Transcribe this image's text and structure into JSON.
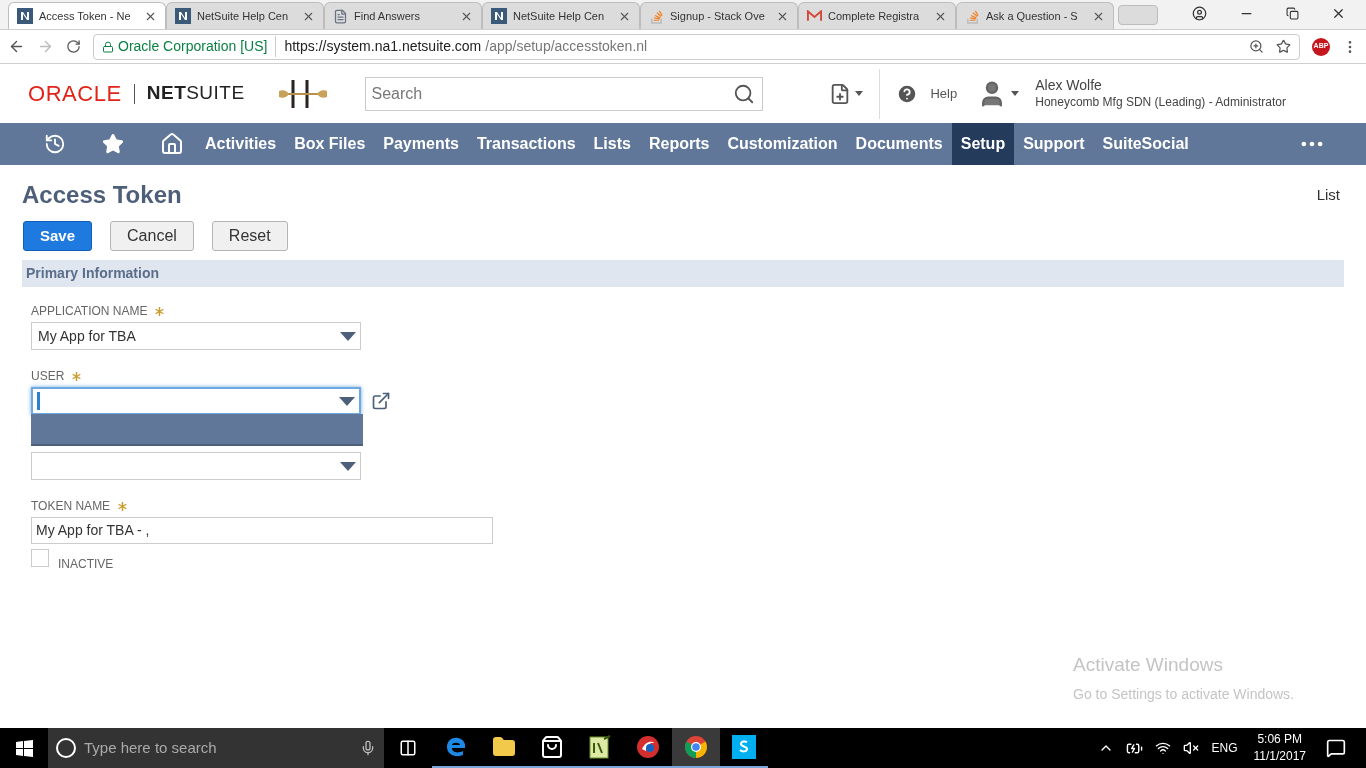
{
  "browser_tabs": [
    {
      "title": "Access Token - Ne",
      "kind": "netsuite",
      "selected": true
    },
    {
      "title": "NetSuite Help Cen",
      "kind": "netsuite",
      "selected": false
    },
    {
      "title": "Find Answers",
      "kind": "page",
      "selected": false
    },
    {
      "title": "NetSuite Help Cen",
      "kind": "netsuite",
      "selected": false
    },
    {
      "title": "Signup - Stack Ove",
      "kind": "stack",
      "selected": false
    },
    {
      "title": "Complete Registra",
      "kind": "mail",
      "selected": false
    },
    {
      "title": "Ask a Question - S",
      "kind": "stack",
      "selected": false
    }
  ],
  "address_bar": {
    "site_identity": "Oracle Corporation [US]",
    "url_host": "https://system.na1.netsuite.com",
    "url_path": "/app/setup/accesstoken.nl",
    "extension_badge": "ABP"
  },
  "header": {
    "oracle_logo": "ORACLE",
    "netsuite_logo": "**NET**SUITE",
    "search": {
      "placeholder": "Search"
    },
    "help": "Help",
    "user_name": "Alex Wolfe",
    "user_role": "Honeycomb Mfg SDN (Leading) - Administrator"
  },
  "nav": [
    {
      "label": "Activities",
      "selected": false
    },
    {
      "label": "Box Files",
      "selected": false
    },
    {
      "label": "Payments",
      "selected": false
    },
    {
      "label": "Transactions",
      "selected": false
    },
    {
      "label": "Lists",
      "selected": false
    },
    {
      "label": "Reports",
      "selected": false
    },
    {
      "label": "Customization",
      "selected": false
    },
    {
      "label": "Documents",
      "selected": false
    },
    {
      "label": "Setup",
      "selected": true
    },
    {
      "label": "Support",
      "selected": false
    },
    {
      "label": "SuiteSocial",
      "selected": false
    }
  ],
  "page": {
    "title": "Access Token",
    "list_link": "List",
    "buttons": [
      {
        "label": "Save",
        "kind": "primary"
      },
      {
        "label": "Cancel",
        "kind": "secondary"
      },
      {
        "label": "Reset",
        "kind": "secondary"
      }
    ],
    "section": "Primary Information",
    "fields": [
      {
        "kind": "select",
        "label": "APPLICATION NAME",
        "required": true,
        "value": "My App for TBA",
        "focused": false
      },
      {
        "kind": "select",
        "label": "USER",
        "required": true,
        "focused": true,
        "dropdown_open": true,
        "link_icon": true
      },
      {
        "kind": "select",
        "required": false,
        "focused": false
      },
      {
        "kind": "text",
        "label": "TOKEN NAME",
        "required": true,
        "value": "My App for TBA - ,"
      },
      {
        "kind": "checkbox",
        "label": "INACTIVE",
        "checked": false
      }
    ]
  },
  "activation_notice": {
    "title": "Activate Windows",
    "text": "Go to Settings to activate Windows."
  },
  "taskbar": {
    "search": {
      "placeholder": "Type here to search"
    },
    "apps": [
      {
        "kind": "edge",
        "active": false
      },
      {
        "kind": "explorer",
        "active": false
      },
      {
        "kind": "store",
        "active": false
      },
      {
        "kind": "notepad",
        "active": false
      },
      {
        "kind": "media",
        "active": false
      },
      {
        "kind": "chrome",
        "active": true
      },
      {
        "kind": "skype",
        "active": false
      }
    ],
    "language": "ENG",
    "time": "5:06 PM",
    "date": "11/1/2017"
  }
}
